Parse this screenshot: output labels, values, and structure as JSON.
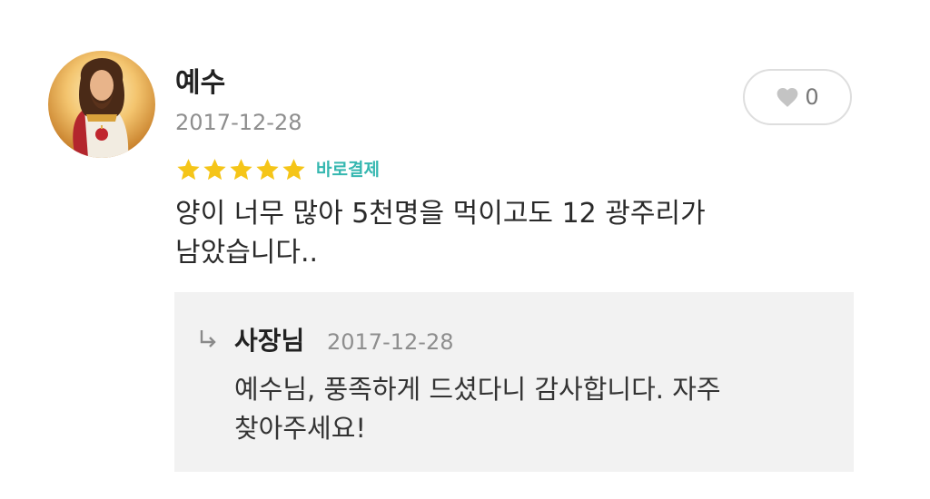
{
  "review": {
    "author": "예수",
    "date": "2017-12-28",
    "avatar_icon": "profile-avatar-icon",
    "rating": 5,
    "rating_max": 5,
    "star_color": "#f5c518",
    "payment_badge": "바로결제",
    "badge_color": "#35b7b0",
    "text": "양이 너무 많아 5천명을 먹이고도 12 광주리가\n남았습니다..",
    "likes": {
      "icon": "heart-icon",
      "count": "0"
    }
  },
  "reply": {
    "arrow_icon": "reply-arrow-icon",
    "author": "사장님",
    "date": "2017-12-28",
    "text": "예수님, 풍족하게 드셨다니 감사합니다. 자주\n찾아주세요!",
    "background": "#f2f2f2"
  }
}
